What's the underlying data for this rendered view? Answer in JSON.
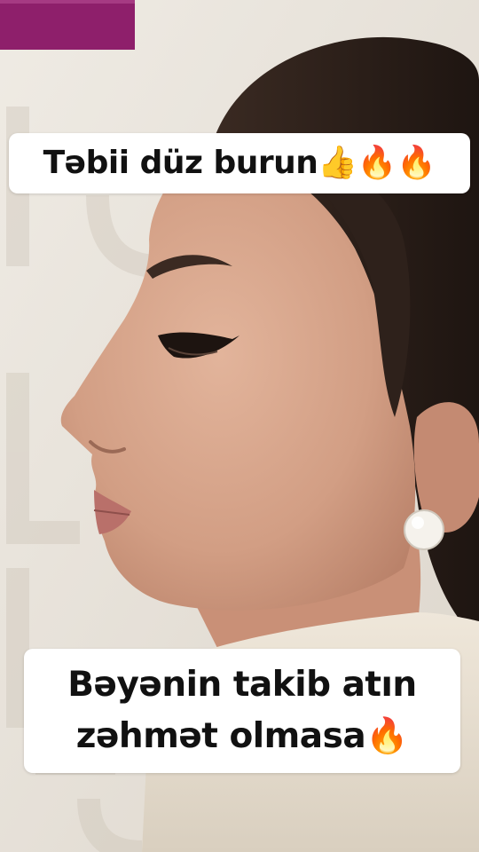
{
  "captions": {
    "top": "Təbii düz burun👍🔥🔥",
    "bottom_line1": "Bəyənin takib atın",
    "bottom_line2": "zəhmət olmasa🔥"
  },
  "colors": {
    "brand_bar": "#8e1f6b",
    "wall": "#e9e4dc",
    "hair": "#2a1e18",
    "skin": "#d9a88e",
    "caption_bg": "#ffffff"
  }
}
